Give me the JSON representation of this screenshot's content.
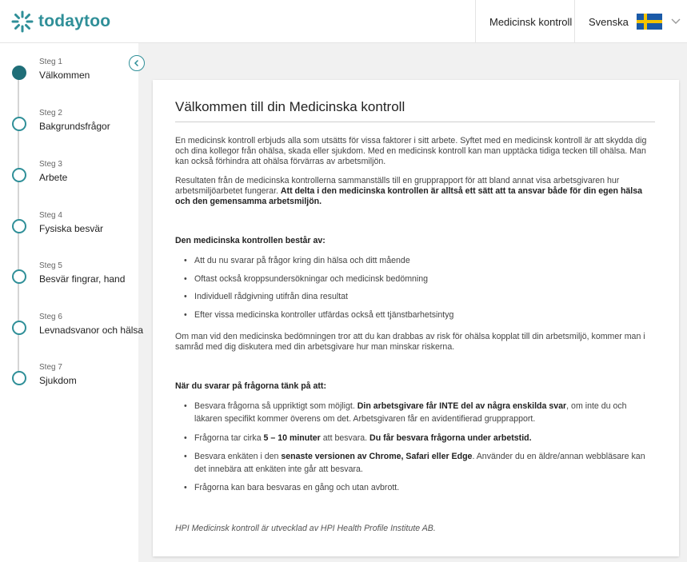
{
  "header": {
    "brand": "todaytoo",
    "nav_item": "Medicinsk kontroll",
    "language": "Svenska"
  },
  "colors": {
    "accent": "#2f8f98",
    "accent_dark": "#1f6e78",
    "flag_blue": "#1a5aa8",
    "flag_yellow": "#f5c400"
  },
  "steps": [
    {
      "num": "Steg 1",
      "name": "Välkommen",
      "active": true
    },
    {
      "num": "Steg 2",
      "name": "Bakgrundsfrågor",
      "active": false
    },
    {
      "num": "Steg 3",
      "name": "Arbete",
      "active": false
    },
    {
      "num": "Steg 4",
      "name": "Fysiska besvär",
      "active": false
    },
    {
      "num": "Steg 5",
      "name": "Besvär fingrar, hand",
      "active": false
    },
    {
      "num": "Steg 6",
      "name": "Levnadsvanor och hälsa",
      "active": false
    },
    {
      "num": "Steg 7",
      "name": "Sjukdom",
      "active": false
    }
  ],
  "content": {
    "title": "Välkommen till din Medicinska kontroll",
    "intro": "En medicinsk kontroll erbjuds alla som utsätts för vissa faktorer i sitt arbete. Syftet med en medicinsk kontroll är att skydda dig och dina kollegor från ohälsa, skada eller sjukdom. Med en medicinsk kontroll kan man upptäcka tidiga tecken till ohälsa. Man kan också förhindra att ohälsa förvärras av arbetsmiljön.",
    "results_text": "Resultaten från de medicinska kontrollerna sammanställs till en grupprapport för att bland annat visa arbetsgivaren hur arbetsmiljöarbetet fungerar. ",
    "results_bold": "Att delta i den medicinska kontrollen är alltså ett sätt att ta ansvar både för din egen hälsa och den gemensamma arbetsmiljön.",
    "consists_heading": "Den medicinska kontrollen består av:",
    "consists_items": [
      "Att du nu svarar på frågor kring din hälsa och ditt mående",
      "Oftast också kroppsundersökningar och medicinsk bedömning",
      "Individuell rådgivning utifrån dina resultat",
      "Efter vissa medicinska kontroller utfärdas också ett tjänstbarhetsintyg"
    ],
    "risk_text": "Om man vid den medicinska bedömningen tror att du kan drabbas av risk för ohälsa kopplat till din arbetsmiljö, kommer man i samråd med dig diskutera med din arbetsgivare hur man minskar riskerna.",
    "think_heading": "När du svarar på frågorna tänk på att:",
    "think_1a": "Besvara frågorna så uppriktigt som möjligt. ",
    "think_1b": "Din arbetsgivare får INTE del av några enskilda svar",
    "think_1c": ", om inte du och läkaren specifikt kommer överens om det. Arbetsgivaren får en avidentifierad grupprapport.",
    "think_2a": "Frågorna tar cirka ",
    "think_2b": "5 – 10 minuter",
    "think_2c": " att besvara. ",
    "think_2d": "Du får besvara frågorna under arbetstid.",
    "think_3a": "Besvara enkäten i den ",
    "think_3b": "senaste versionen av Chrome, Safari eller Edge",
    "think_3c": ". Använder du en äldre/annan webbläsare kan det innebära att enkäten inte går att besvara.",
    "think_4": "Frågorna kan bara besvaras en gång och utan avbrott.",
    "footer": "HPI Medicinsk kontroll är utvecklad av HPI Health Profile Institute AB."
  }
}
